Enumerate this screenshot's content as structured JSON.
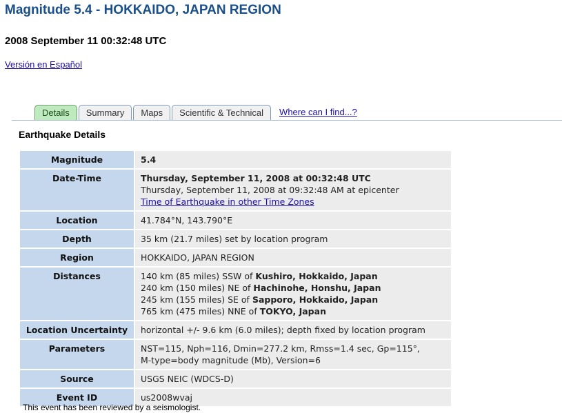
{
  "header": {
    "title": "Magnitude 5.4 - HOKKAIDO, JAPAN REGION",
    "datetime": "2008 September 11 00:32:48 UTC",
    "spanish_link": "Versión en Español"
  },
  "tabs": [
    {
      "label": "Details",
      "active": true
    },
    {
      "label": "Summary",
      "active": false
    },
    {
      "label": "Maps",
      "active": false
    },
    {
      "label": "Scientific & Technical",
      "active": false
    }
  ],
  "tabs_link": "Where can I find...?",
  "section_title": "Earthquake Details",
  "details": {
    "magnitude": {
      "label": "Magnitude",
      "value": "5.4"
    },
    "datetime": {
      "label": "Date-Time",
      "utc": "Thursday, September 11, 2008 at 00:32:48 UTC",
      "local": "Thursday, September 11, 2008 at 09:32:48 AM at epicenter",
      "tz_link": "Time of Earthquake in other Time Zones"
    },
    "location": {
      "label": "Location",
      "value": "41.784°N, 143.790°E"
    },
    "depth": {
      "label": "Depth",
      "value": "35 km (21.7 miles) set by location program"
    },
    "region": {
      "label": "Region",
      "value": "HOKKAIDO, JAPAN REGION"
    },
    "distances": {
      "label": "Distances",
      "items": [
        {
          "prefix": "140 km (85 miles) SSW of ",
          "place": "Kushiro, Hokkaido, Japan"
        },
        {
          "prefix": "240 km (150 miles) NE of ",
          "place": "Hachinohe, Honshu, Japan"
        },
        {
          "prefix": "245 km (155 miles) SE of ",
          "place": "Sapporo, Hokkaido, Japan"
        },
        {
          "prefix": "765 km (475 miles) NNE of ",
          "place": "TOKYO, Japan"
        }
      ]
    },
    "uncertainty": {
      "label": "Location Uncertainty",
      "value": "horizontal +/- 9.6 km (6.0 miles); depth fixed by location program"
    },
    "parameters": {
      "label": "Parameters",
      "line1": "NST=115, Nph=116, Dmin=277.2 km, Rmss=1.4 sec, Gp=115°,",
      "line2": "M-type=body magnitude (Mb), Version=6"
    },
    "source": {
      "label": "Source",
      "value": "USGS NEIC (WDCS-D)"
    },
    "event_id": {
      "label": "Event ID",
      "value": "us2008wvaj"
    }
  },
  "footer": "This event has been reviewed by a seismologist."
}
